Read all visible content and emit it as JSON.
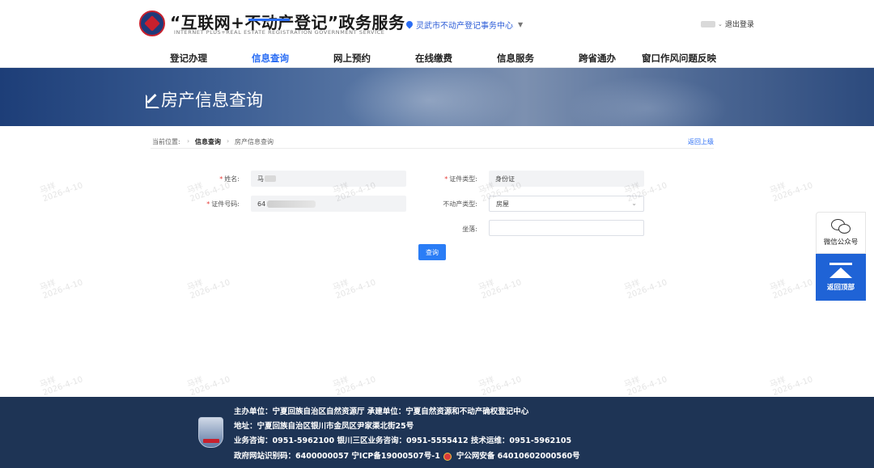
{
  "header": {
    "title": "“互联网+不动产登记”政务服务",
    "subtitle": "INTERNET PLUS+REAL ESTATE REGISTRATION GOVERNMENT SERVICE",
    "location": "灵武市不动产登记事务中心",
    "logout": "退出登录"
  },
  "nav": {
    "items": [
      "登记办理",
      "信息查询",
      "网上预约",
      "在线缴费",
      "信息服务",
      "跨省通办",
      "窗口作风问题反映"
    ],
    "active": "信息查询"
  },
  "banner": {
    "title": "房产信息查询"
  },
  "breadcrumb": {
    "label": "当前位置:",
    "sep": "›",
    "level1": "信息查询",
    "level2": "房产信息查询",
    "back": "返回上级"
  },
  "form": {
    "name_label": "姓名:",
    "name_value": "马",
    "cert_type_label": "证件类型:",
    "cert_type_value": "身份证",
    "cert_no_label": "证件号码:",
    "cert_no_value": "64",
    "property_type_label": "不动产类型:",
    "property_type_value": "房屋",
    "location_label": "坐落:",
    "location_value": "",
    "required_mark": "*",
    "query_button": "查询"
  },
  "watermark": {
    "name": "马祥",
    "date": "2026-4-10"
  },
  "side": {
    "wechat_label": "微信公众号",
    "top_label": "返回顶部"
  },
  "footer": {
    "line1": "主办单位：宁夏回族自治区自然资源厅   承建单位：宁夏自然资源和不动产确权登记中心",
    "line2": "地址：宁夏回族自治区银川市金凤区尹家渠北街25号",
    "line3": "业务咨询：0951-5962100   银川三区业务咨询：0951-5555412   技术运维：0951-5962105",
    "line4a": "政府网站识别码：6400000057   宁ICP备19000507号-1",
    "line4b": "宁公网安备 64010602000560号"
  }
}
